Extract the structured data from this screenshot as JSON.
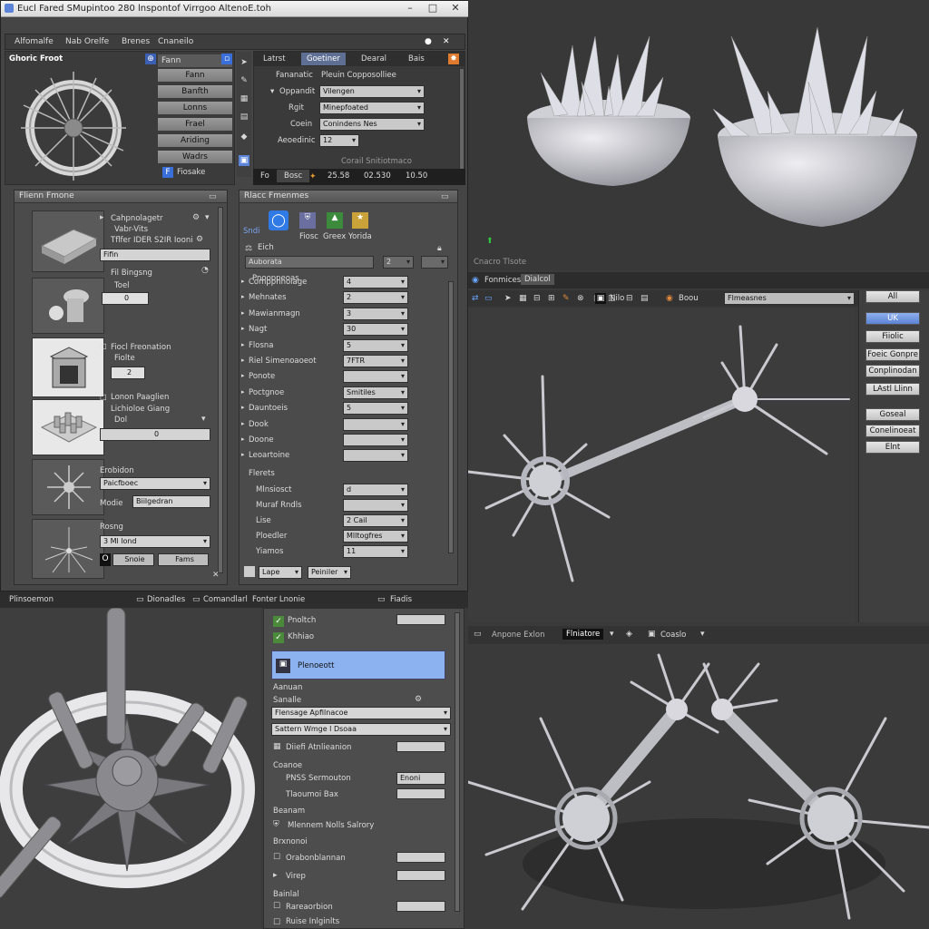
{
  "window": {
    "title": "Eucl Fared SMupintoo 280 lnspontof Virrgoo AltenoE.toh",
    "menu": [
      "Alfomalfe",
      "Nab Orelfe",
      "Brenes",
      "Cnaneilo"
    ]
  },
  "top_left": {
    "label": "Ghoric Froot",
    "buttons": [
      "Fann",
      "Banfth",
      "Lonns",
      "Frael",
      "Ariding",
      "Wadrs"
    ],
    "bottom_label": "Fiosake"
  },
  "top_right": {
    "tabs": [
      "Latrst",
      "Goetiner",
      "Dearal",
      "Bais"
    ],
    "rows": [
      {
        "label": "Fananatic",
        "value": "Pleuin Copposolliee"
      },
      {
        "label": "Oppandit",
        "value": "Vilengen"
      },
      {
        "label": "Rgit",
        "value": "Minepfoated"
      },
      {
        "label": "Coein",
        "value": "Conindens Nes"
      },
      {
        "label": "Aeoedinic",
        "value": "12"
      }
    ],
    "hint": "Corail Snitiotmaco",
    "strip": [
      "Fo",
      "Bosc",
      "25.58",
      "02.530",
      "10.50"
    ]
  },
  "left_panel": {
    "title": "Flienn Fmone",
    "items": [
      {
        "l1": "Cahpnolagetr",
        "l2": "Vabr-Vits",
        "l3": "Tflfer IDER S2IR Iooni",
        "box": "Fifin"
      },
      {
        "l1": "Fil Bingsng",
        "l2": "Toel",
        "box": "0"
      },
      {
        "l1": "Fiocl Freonation",
        "l2": "Fiolte",
        "box": "2"
      },
      {
        "l1": "Lonon Paaglien",
        "l2": "Lichioloe Giang",
        "l3": "Dol",
        "box": "0"
      },
      {
        "l1": "Erobidon",
        "box": "Paicfboec",
        "l2": "Modie",
        "box2": "Biilgedran"
      },
      {
        "l1": "Rosng",
        "box": "3 Ml lond",
        "b1": "Snoie",
        "b2": "Fams"
      }
    ]
  },
  "mid_panel": {
    "title": "Rlacc Fmenmes",
    "icons": [
      "Sndi",
      "Fiosc",
      "Greex",
      "Yorida"
    ],
    "sec": "Eich",
    "search": "Auborata",
    "sub": "Pnooppeoas",
    "rows": [
      {
        "label": "Comppnnoiage",
        "value": "4"
      },
      {
        "label": "Mehnates",
        "value": "2"
      },
      {
        "label": "Mawianmagn",
        "value": "3"
      },
      {
        "label": "Nagt",
        "value": "30"
      },
      {
        "label": "Flosna",
        "value": "5"
      },
      {
        "label": "Riel Simenoaoeot",
        "value": "7FTR"
      },
      {
        "label": "Ponote",
        "value": ""
      },
      {
        "label": "Poctgnoe",
        "value": "Smitiles"
      },
      {
        "label": "Dauntoeis",
        "value": "5"
      },
      {
        "label": "Dook",
        "value": ""
      },
      {
        "label": "Doone",
        "value": ""
      },
      {
        "label": "Leoartoine",
        "value": ""
      }
    ],
    "sec2": "Flerets",
    "rows2": [
      {
        "label": "Mlnsiosct",
        "value": "d"
      },
      {
        "label": "Muraf Rndls",
        "value": ""
      },
      {
        "label": "Lise",
        "value": "2 Cail"
      },
      {
        "label": "Ploedler",
        "value": "Mlltogfres"
      },
      {
        "label": "Yiamos",
        "value": "11"
      }
    ],
    "footer": [
      "Lape",
      "Peiniler"
    ]
  },
  "bottom_left": {
    "tabs": [
      "Plinsoemon",
      "Dionadles",
      "Comandlarl",
      "Fonter Lnonie",
      "Fiadis"
    ]
  },
  "bottom_mid": {
    "items": [
      "Pnoltch",
      "Khhiao"
    ],
    "selected": "Plenoeott",
    "sec1": "Aanuan",
    "l1": "Sanalle",
    "dd": [
      "Flensage Apfilnacoe",
      "Sattern Wmge l Dsoaa"
    ],
    "r1": "Diiefi Atnlieanion",
    "sec2": "Coanoe",
    "r2": "PNSS Sermouton",
    "r2b": "Enoni",
    "r3": "Tlaoumoi Bax",
    "sec3": "Beanam",
    "r4": "Mlennem Nolls Salrory",
    "sec4": "Brxnonoi",
    "r5": "Orabonblannan",
    "r6": "Virep",
    "sec5": "Bainlal",
    "r7": "Rareaorbion",
    "r8": "Ruise Inlginlts"
  },
  "top_right_vp": {
    "caption": "Cnacro Tlsote"
  },
  "mid_right": {
    "tab1": "Fonmices",
    "tab2": "Dialcol",
    "num": "Nilo",
    "search": "Boou",
    "field": "Flmeasnes",
    "buttons": [
      "All",
      "UK",
      "Fiiolic",
      "Foeic Gonpre",
      "Conplinodan",
      "LAstl Llinn",
      "Goseal",
      "Conelinoeat",
      "Elnt"
    ]
  },
  "bottom_right_bar": {
    "a": "Anpone Exlon",
    "b": "Flniatore",
    "c": "Coaslo"
  },
  "colors": {
    "accent": "#5b84d8",
    "panel": "#4b4b4b",
    "input": "#c9c9c9"
  }
}
